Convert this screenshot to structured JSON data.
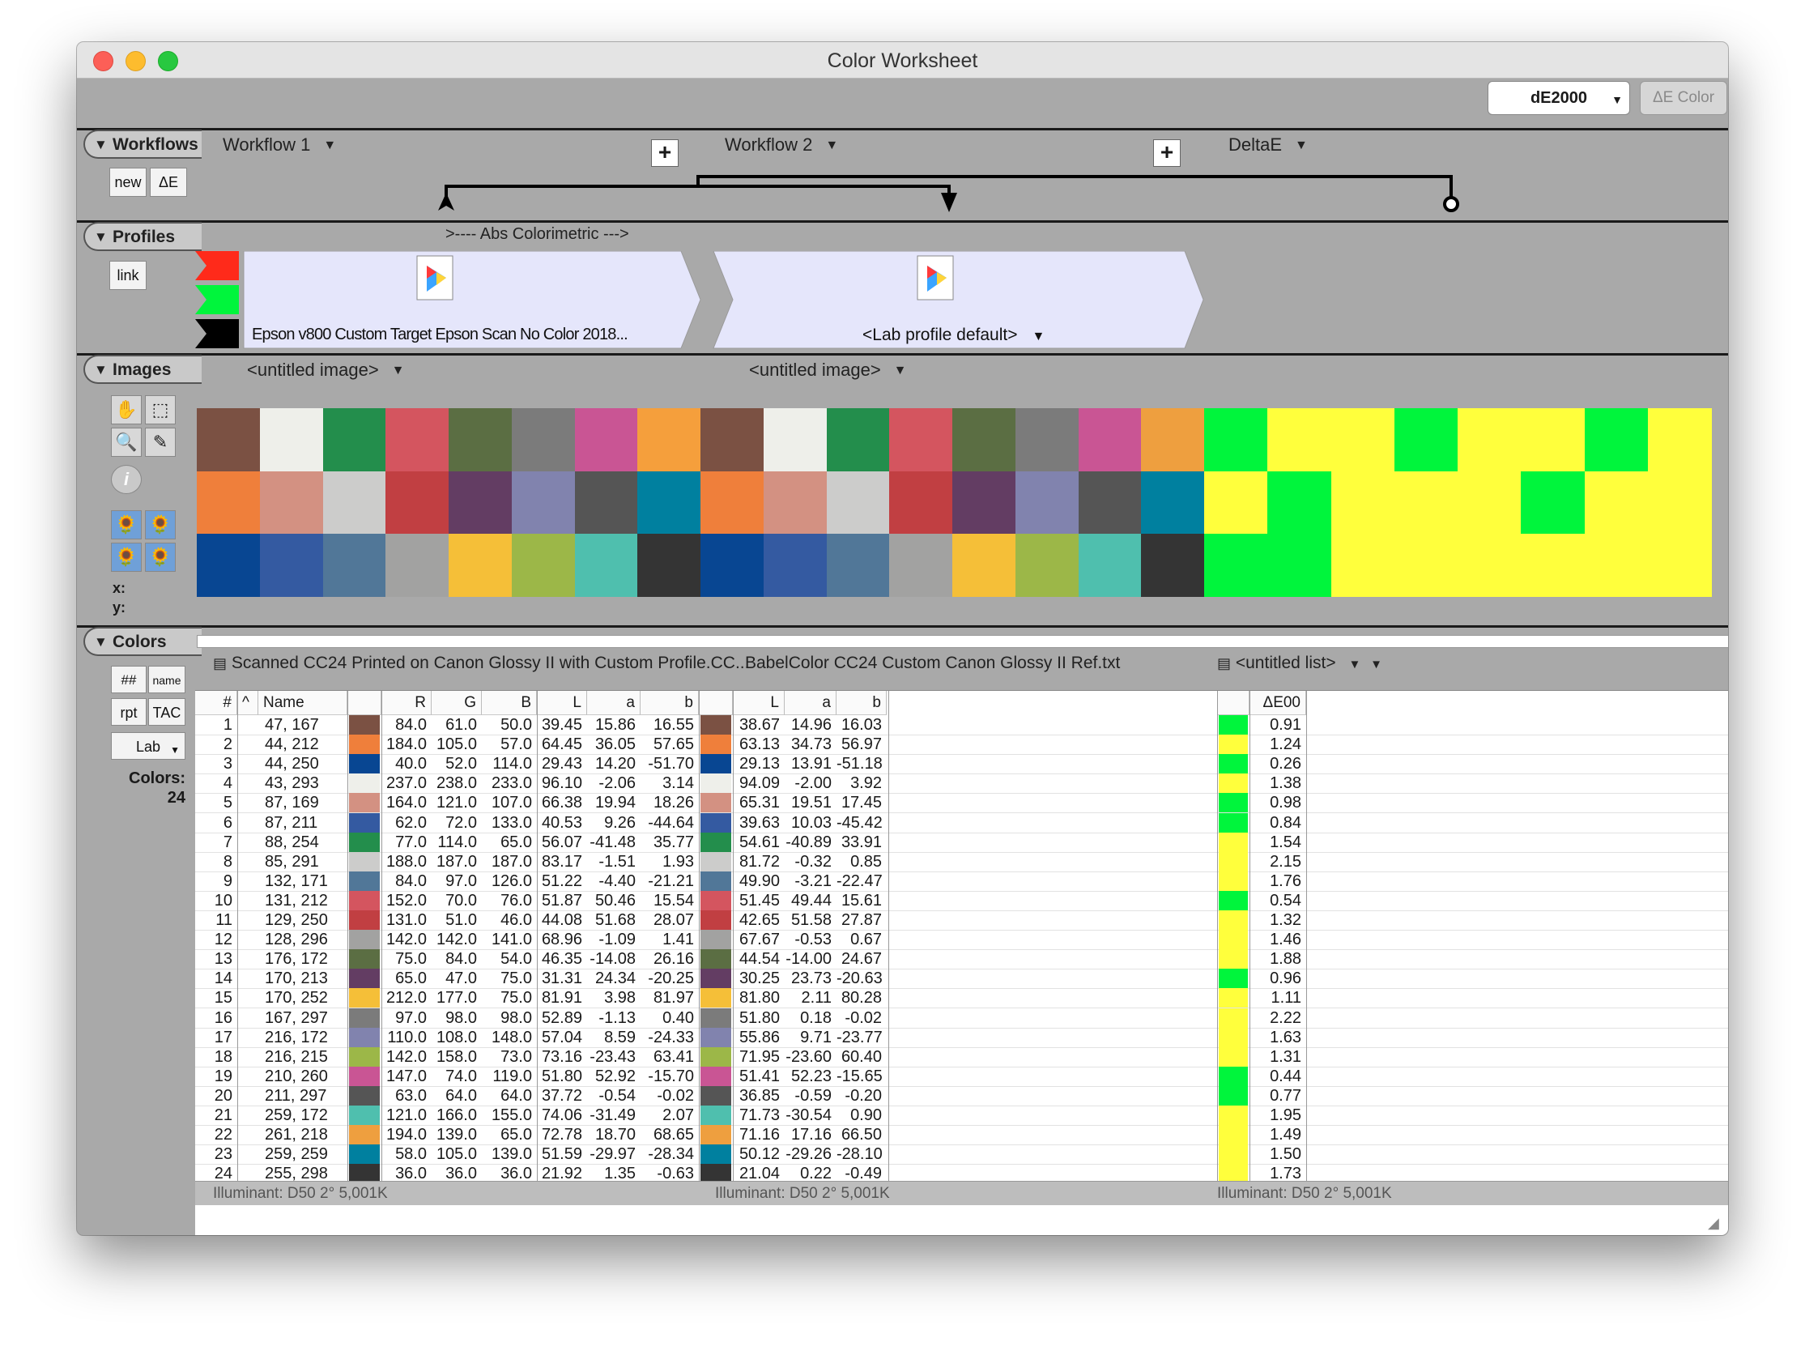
{
  "window": {
    "title": "Color Worksheet"
  },
  "toolbar": {
    "metric_select": "dE2000",
    "delta_button": "ΔE Color"
  },
  "sections": {
    "workflows": {
      "label": "Workflows",
      "new_button": "new",
      "delta_button": "ΔE",
      "items": [
        "Workflow 1",
        "Workflow 2",
        "DeltaE"
      ]
    },
    "profiles": {
      "label": "Profiles",
      "link_button": "link",
      "intent": ">---- Abs Colorimetric --->",
      "profile1": "Epson v800 Custom Target Epson Scan No Color 2018...",
      "profile2": "<Lab profile default>"
    },
    "images": {
      "label": "Images",
      "image1": "<untitled image>",
      "image2": "<untitled image>",
      "x_label": "x:",
      "y_label": "y:"
    },
    "colors": {
      "label": "Colors",
      "hash_button": "##",
      "name_button": "name",
      "rpt_button": "rpt",
      "tac_button": "TAC",
      "lab_select": "Lab",
      "count_label": "Colors:",
      "count_value": "24"
    }
  },
  "lists": {
    "list1": "Scanned CC24 Printed on Canon Glossy II with Custom Profile.CC...",
    "list2": "BabelColor CC24 Custom Canon Glossy II Ref.txt",
    "list3": "<untitled list>",
    "illuminant1": "Illuminant: D50 2° 5,001K",
    "illuminant2": "Illuminant: D50 2° 5,001K",
    "illuminant3": "Illuminant: D50 2° 5,001K"
  },
  "table": {
    "headers": {
      "num": "#",
      "sort": "^",
      "name": "Name",
      "R": "R",
      "G": "G",
      "B": "B",
      "L": "L",
      "a": "a",
      "b": "b",
      "L2": "L",
      "a2": "a",
      "b2": "b",
      "dE": "ΔE00"
    },
    "rows": [
      {
        "n": "1",
        "name": "47, 167",
        "R": "84.0",
        "G": "61.0",
        "B": "50.0",
        "L": "39.45",
        "a": "15.86",
        "b": "16.55",
        "L2": "38.67",
        "a2": "14.96",
        "b2": "16.03",
        "de": "0.91",
        "sw1": "#7b5143",
        "sw2": "#7b5143",
        "ind": "#00f53c"
      },
      {
        "n": "2",
        "name": "44, 212",
        "R": "184.0",
        "G": "105.0",
        "B": "57.0",
        "L": "64.45",
        "a": "36.05",
        "b": "57.65",
        "L2": "63.13",
        "a2": "34.73",
        "b2": "56.97",
        "de": "1.24",
        "sw1": "#ef7f3b",
        "sw2": "#ef7f3b",
        "ind": "#ffff3c"
      },
      {
        "n": "3",
        "name": "44, 250",
        "R": "40.0",
        "G": "52.0",
        "B": "114.0",
        "L": "29.43",
        "a": "14.20",
        "b": "-51.70",
        "L2": "29.13",
        "a2": "13.91",
        "b2": "-51.18",
        "de": "0.26",
        "sw1": "#084692",
        "sw2": "#084692",
        "ind": "#00f53c"
      },
      {
        "n": "4",
        "name": "43, 293",
        "R": "237.0",
        "G": "238.0",
        "B": "233.0",
        "L": "96.10",
        "a": "-2.06",
        "b": "3.14",
        "L2": "94.09",
        "a2": "-2.00",
        "b2": "3.92",
        "de": "1.38",
        "sw1": "#eeefea",
        "sw2": "#eeefea",
        "ind": "#ffff3c"
      },
      {
        "n": "5",
        "name": "87, 169",
        "R": "164.0",
        "G": "121.0",
        "B": "107.0",
        "L": "66.38",
        "a": "19.94",
        "b": "18.26",
        "L2": "65.31",
        "a2": "19.51",
        "b2": "17.45",
        "de": "0.98",
        "sw1": "#d39182",
        "sw2": "#d39182",
        "ind": "#00f53c"
      },
      {
        "n": "6",
        "name": "87, 211",
        "R": "62.0",
        "G": "72.0",
        "B": "133.0",
        "L": "40.53",
        "a": "9.26",
        "b": "-44.64",
        "L2": "39.63",
        "a2": "10.03",
        "b2": "-45.42",
        "de": "0.84",
        "sw1": "#345aa1",
        "sw2": "#345aa1",
        "ind": "#00f53c"
      },
      {
        "n": "7",
        "name": "88, 254",
        "R": "77.0",
        "G": "114.0",
        "B": "65.0",
        "L": "56.07",
        "a": "-41.48",
        "b": "35.77",
        "L2": "54.61",
        "a2": "-40.89",
        "b2": "33.91",
        "de": "1.54",
        "sw1": "#238e4c",
        "sw2": "#238e4c",
        "ind": "#ffff3c"
      },
      {
        "n": "8",
        "name": "85, 291",
        "R": "188.0",
        "G": "187.0",
        "B": "187.0",
        "L": "83.17",
        "a": "-1.51",
        "b": "1.93",
        "L2": "81.72",
        "a2": "-0.32",
        "b2": "0.85",
        "de": "2.15",
        "sw1": "#cccccb",
        "sw2": "#cccccb",
        "ind": "#ffff3c"
      },
      {
        "n": "9",
        "name": "132, 171",
        "R": "84.0",
        "G": "97.0",
        "B": "126.0",
        "L": "51.22",
        "a": "-4.40",
        "b": "-21.21",
        "L2": "49.90",
        "a2": "-3.21",
        "b2": "-22.47",
        "de": "1.76",
        "sw1": "#517798",
        "sw2": "#517798",
        "ind": "#ffff3c"
      },
      {
        "n": "10",
        "name": "131, 212",
        "R": "152.0",
        "G": "70.0",
        "B": "76.0",
        "L": "51.87",
        "a": "50.46",
        "b": "15.54",
        "L2": "51.45",
        "a2": "49.44",
        "b2": "15.61",
        "de": "0.54",
        "sw1": "#d4555f",
        "sw2": "#d4555f",
        "ind": "#00f53c"
      },
      {
        "n": "11",
        "name": "129, 250",
        "R": "131.0",
        "G": "51.0",
        "B": "46.0",
        "L": "44.08",
        "a": "51.68",
        "b": "28.07",
        "L2": "42.65",
        "a2": "51.58",
        "b2": "27.87",
        "de": "1.32",
        "sw1": "#c13f42",
        "sw2": "#c13f42",
        "ind": "#ffff3c"
      },
      {
        "n": "12",
        "name": "128, 296",
        "R": "142.0",
        "G": "142.0",
        "B": "141.0",
        "L": "68.96",
        "a": "-1.09",
        "b": "1.41",
        "L2": "67.67",
        "a2": "-0.53",
        "b2": "0.67",
        "de": "1.46",
        "sw1": "#a2a2a1",
        "sw2": "#a2a2a1",
        "ind": "#ffff3c"
      },
      {
        "n": "13",
        "name": "176, 172",
        "R": "75.0",
        "G": "84.0",
        "B": "54.0",
        "L": "46.35",
        "a": "-14.08",
        "b": "26.16",
        "L2": "44.54",
        "a2": "-14.00",
        "b2": "24.67",
        "de": "1.88",
        "sw1": "#5b6e43",
        "sw2": "#5b6e43",
        "ind": "#ffff3c"
      },
      {
        "n": "14",
        "name": "170, 213",
        "R": "65.0",
        "G": "47.0",
        "B": "75.0",
        "L": "31.31",
        "a": "24.34",
        "b": "-20.25",
        "L2": "30.25",
        "a2": "23.73",
        "b2": "-20.63",
        "de": "0.96",
        "sw1": "#633d63",
        "sw2": "#633d63",
        "ind": "#00f53c"
      },
      {
        "n": "15",
        "name": "170, 252",
        "R": "212.0",
        "G": "177.0",
        "B": "75.0",
        "L": "81.91",
        "a": "3.98",
        "b": "81.97",
        "L2": "81.80",
        "a2": "2.11",
        "b2": "80.28",
        "de": "1.11",
        "sw1": "#f5bf38",
        "sw2": "#f5bf38",
        "ind": "#ffff3c"
      },
      {
        "n": "16",
        "name": "167, 297",
        "R": "97.0",
        "G": "98.0",
        "B": "98.0",
        "L": "52.89",
        "a": "-1.13",
        "b": "0.40",
        "L2": "51.80",
        "a2": "0.18",
        "b2": "-0.02",
        "de": "2.22",
        "sw1": "#7b7b7b",
        "sw2": "#7b7b7b",
        "ind": "#ffff3c"
      },
      {
        "n": "17",
        "name": "216, 172",
        "R": "110.0",
        "G": "108.0",
        "B": "148.0",
        "L": "57.04",
        "a": "8.59",
        "b": "-24.33",
        "L2": "55.86",
        "a2": "9.71",
        "b2": "-23.77",
        "de": "1.63",
        "sw1": "#8183ae",
        "sw2": "#8183ae",
        "ind": "#ffff3c"
      },
      {
        "n": "18",
        "name": "216, 215",
        "R": "142.0",
        "G": "158.0",
        "B": "73.0",
        "L": "73.16",
        "a": "-23.43",
        "b": "63.41",
        "L2": "71.95",
        "a2": "-23.60",
        "b2": "60.40",
        "de": "1.31",
        "sw1": "#9cb748",
        "sw2": "#9cb748",
        "ind": "#ffff3c"
      },
      {
        "n": "19",
        "name": "210, 260",
        "R": "147.0",
        "G": "74.0",
        "B": "119.0",
        "L": "51.80",
        "a": "52.92",
        "b": "-15.70",
        "L2": "51.41",
        "a2": "52.23",
        "b2": "-15.65",
        "de": "0.44",
        "sw1": "#c95594",
        "sw2": "#c95594",
        "ind": "#00f53c"
      },
      {
        "n": "20",
        "name": "211, 297",
        "R": "63.0",
        "G": "64.0",
        "B": "64.0",
        "L": "37.72",
        "a": "-0.54",
        "b": "-0.02",
        "L2": "36.85",
        "a2": "-0.59",
        "b2": "-0.20",
        "de": "0.77",
        "sw1": "#555555",
        "sw2": "#555555",
        "ind": "#00f53c"
      },
      {
        "n": "21",
        "name": "259, 172",
        "R": "121.0",
        "G": "166.0",
        "B": "155.0",
        "L": "74.06",
        "a": "-31.49",
        "b": "2.07",
        "L2": "71.73",
        "a2": "-30.54",
        "b2": "0.90",
        "de": "1.95",
        "sw1": "#4fbfae",
        "sw2": "#4fbfae",
        "ind": "#ffff3c"
      },
      {
        "n": "22",
        "name": "261, 218",
        "R": "194.0",
        "G": "139.0",
        "B": "65.0",
        "L": "72.78",
        "a": "18.70",
        "b": "68.65",
        "L2": "71.16",
        "a2": "17.16",
        "b2": "66.50",
        "de": "1.49",
        "sw1": "#ee9f3f",
        "sw2": "#ee9f3f",
        "ind": "#ffff3c"
      },
      {
        "n": "23",
        "name": "259, 259",
        "R": "58.0",
        "G": "105.0",
        "B": "139.0",
        "L": "51.59",
        "a": "-29.97",
        "b": "-28.34",
        "L2": "50.12",
        "a2": "-29.26",
        "b2": "-28.10",
        "de": "1.50",
        "sw1": "#00809f",
        "sw2": "#00809f",
        "ind": "#ffff3c"
      },
      {
        "n": "24",
        "name": "255, 298",
        "R": "36.0",
        "G": "36.0",
        "B": "36.0",
        "L": "21.92",
        "a": "1.35",
        "b": "-0.63",
        "L2": "21.04",
        "a2": "0.22",
        "b2": "-0.49",
        "de": "1.73",
        "sw1": "#343434",
        "sw2": "#343434",
        "ind": "#ffff3c"
      }
    ]
  },
  "image_grid": {
    "chart1": [
      "#7b5143",
      "#eeefea",
      "#238e4c",
      "#d4555f",
      "#5b6e43",
      "#7b7b7b",
      "#c95594",
      "#f59f3c",
      "#ef7f3b",
      "#d39182",
      "#cccccb",
      "#c13f42",
      "#633d63",
      "#8183ae",
      "#555555",
      "#00809f",
      "#084692",
      "#345aa1",
      "#517798",
      "#a2a2a1",
      "#f5bf38",
      "#9cb748",
      "#4fbfae",
      "#343434"
    ],
    "chart2": [
      "#7b5143",
      "#eeefea",
      "#238e4c",
      "#d4555f",
      "#5b6e43",
      "#7b7b7b",
      "#c95594",
      "#ee9f3f",
      "#ef7f3b",
      "#d39182",
      "#cccccb",
      "#c13f42",
      "#633d63",
      "#8183ae",
      "#555555",
      "#00809f",
      "#084692",
      "#345aa1",
      "#517798",
      "#a2a2a1",
      "#f5bf38",
      "#9cb748",
      "#4fbfae",
      "#343434"
    ],
    "delta": [
      "#00f53c",
      "#ffff3c",
      "#ffff3c",
      "#00f53c",
      "#ffff3c",
      "#ffff3c",
      "#00f53c",
      "#ffff3c",
      "#ffff3c",
      "#00f53c",
      "#ffff3c",
      "#ffff3c",
      "#ffff3c",
      "#00f53c",
      "#ffff3c",
      "#ffff3c",
      "#00f53c",
      "#00f53c",
      "#ffff3c",
      "#ffff3c",
      "#ffff3c",
      "#ffff3c",
      "#ffff3c",
      "#ffff3c"
    ]
  }
}
